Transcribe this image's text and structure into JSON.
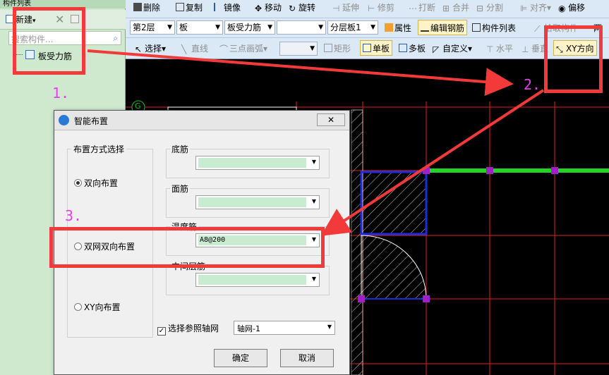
{
  "left_panel": {
    "title": "构件列表",
    "toolbar": {
      "new_label": "新建",
      "new_arrow": "▾",
      "delete_glyph": "✕"
    },
    "search_placeholder": "搜索构件...",
    "tree_item": "板受力筋"
  },
  "toolbar": {
    "row1": [
      {
        "label": "删除",
        "icon": "eraser-icon"
      },
      {
        "label": "复制",
        "icon": "copy-icon"
      },
      {
        "label": "镜像",
        "icon": "mirror-icon"
      },
      {
        "label": "移动",
        "icon": "move-icon"
      },
      {
        "label": "旋转",
        "icon": "rotate-icon"
      },
      {
        "label": "延伸",
        "icon": "extend-icon"
      },
      {
        "label": "修剪",
        "icon": "trim-icon"
      },
      {
        "label": "打断",
        "icon": "break-icon"
      },
      {
        "label": "合并",
        "icon": "merge-icon"
      },
      {
        "label": "分割",
        "icon": "split-icon"
      },
      {
        "label": "对齐",
        "icon": "align-icon"
      },
      {
        "label": "偏移",
        "icon": "offset-icon"
      }
    ],
    "row2": {
      "floor": "第2层",
      "type": "板",
      "subtype": "板受力筋",
      "empty_combo": "",
      "layer": "分层板1",
      "attr_label": "属性",
      "edit_rebar_label": "编辑钢筋",
      "list_label": "构件列表",
      "extra_label": "拾取构件",
      "extra2_label": "两"
    },
    "row3": {
      "select_label": "选择",
      "line_label": "直线",
      "arc_label": "三点画弧",
      "rect_label": "矩形",
      "single_label": "单板",
      "multi_label": "多板",
      "custom_label": "自定义",
      "horizontal_label": "水平",
      "vertical_label": "垂直",
      "xy_label": "XY方向"
    }
  },
  "canvas": {
    "axis_label": "G"
  },
  "dialog": {
    "title": "智能布置",
    "close_glyph": "✕",
    "layout_group_label": "布置方式选择",
    "radio_options": [
      {
        "label": "双向布置",
        "checked": true
      },
      {
        "label": "双网双向布置",
        "checked": false
      },
      {
        "label": "XY向布置",
        "checked": false
      }
    ],
    "fields": [
      {
        "label": "底筋",
        "value": ""
      },
      {
        "label": "面筋",
        "value": ""
      },
      {
        "label": "温度筋",
        "value": "A8@200"
      },
      {
        "label": "中间层筋",
        "value": ""
      }
    ],
    "checkbox_label": "选择参照轴网",
    "checkbox_checked": true,
    "grid_select": "轴网-1",
    "ok_label": "确定",
    "cancel_label": "取消"
  },
  "annotations": {
    "one": "1.",
    "two": "2.",
    "three": "3."
  },
  "colors": {
    "annotation_red": "#f23a3a",
    "annotation_magenta": "#e640e6",
    "panel_green": "#cfe9cf",
    "field_green": "#c9ebd0"
  }
}
